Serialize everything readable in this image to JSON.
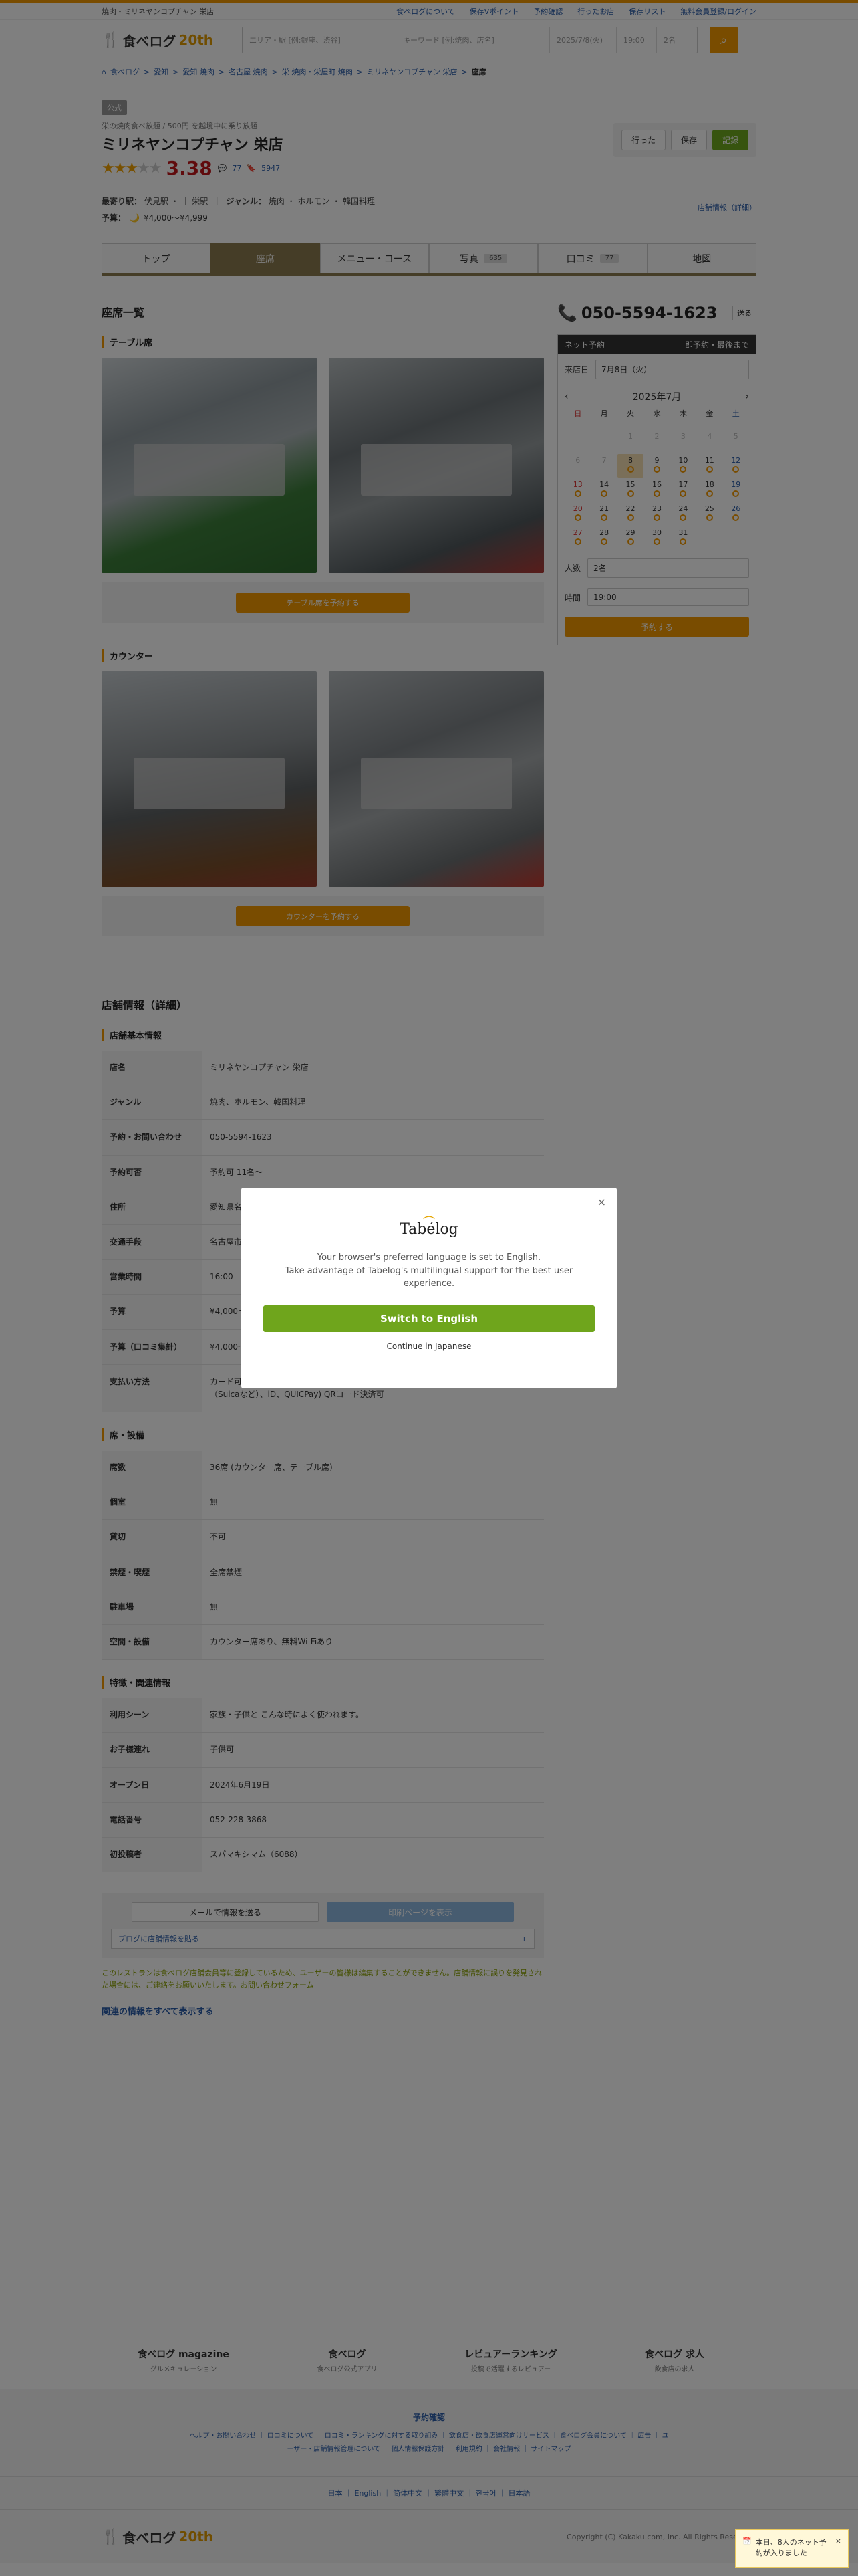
{
  "header": {
    "top_text": "焼肉・ミリネヤンコプチャン 栄店",
    "links": [
      "食べログについて",
      "保存Vポイント",
      "予約確認",
      "行ったお店",
      "保存リスト",
      "無料会員登録/ログイン"
    ],
    "logo_text": "食べログ",
    "logo_anniv": "20th",
    "search_area_placeholder": "エリア・駅 [例:銀座、渋谷]",
    "search_keyword_placeholder": "キーワード [例:焼肉、店名]",
    "search_date": "2025/7/8(火)",
    "search_time": "19:00",
    "search_people": "2名"
  },
  "breadcrumb": [
    "食べログ",
    "愛知",
    "愛知 焼肉",
    "名古屋 焼肉",
    "栄 焼肉・栄屋町 焼肉",
    "ミリネヤンコプチャン 栄店",
    "座席"
  ],
  "shop": {
    "badge": "公式",
    "subtitle": "栄の焼肉食べ放題 / 500円 を越境中に乗り放題",
    "name": "ミリネヤンコプチャン 栄店",
    "score": "3.38",
    "stars": 3,
    "reviews": "77",
    "saves": "5947",
    "nearest_label": "最寄り駅：",
    "nearest": "伏見駅 ・ ｜ 栄駅",
    "genre_label": "ジャンル：",
    "genre": "焼肉 ・ ホルモン ・ 韓国料理",
    "budget_label": "予算：",
    "budget": "¥4,000～¥4,999",
    "went_btn": "行った",
    "save_btn": "保存",
    "reserve_btn": "記録",
    "report_link": "店舗情報（詳細）"
  },
  "tabs": [
    {
      "label": "トップ",
      "count": ""
    },
    {
      "label": "座席",
      "count": ""
    },
    {
      "label": "メニュー・コース",
      "count": ""
    },
    {
      "label": "写真",
      "count": "635"
    },
    {
      "label": "口コミ",
      "count": "77"
    },
    {
      "label": "地図",
      "count": ""
    }
  ],
  "seats": {
    "title": "座席一覧",
    "table_title": "テーブル席",
    "table_btn": "テーブル席を予約する",
    "counter_title": "カウンター",
    "counter_btn": "カウンターを予約する"
  },
  "details": {
    "title": "店舗情報（詳細）",
    "basic_title": "店舗基本情報",
    "rows": [
      {
        "k": "店名",
        "v": "ミリネヤンコプチャン 栄店"
      },
      {
        "k": "ジャンル",
        "v": "焼肉、ホルモン、韓国料理"
      },
      {
        "k": "予約・お問い合わせ",
        "v": "050-5594-1623"
      },
      {
        "k": "予約可否",
        "v": "予約可 11名～"
      },
      {
        "k": "住所",
        "v": "愛知県名古屋市..."
      },
      {
        "k": "交通手段",
        "v": "名古屋市営東山線 伏見駅から586m"
      },
      {
        "k": "営業時間",
        "v": "16:00 - 23:30 L.O. 23:00"
      },
      {
        "k": "予算",
        "v": "¥4,000～¥4,999"
      },
      {
        "k": "予算（口コミ集計）",
        "v": "¥4,000～¥4,999"
      },
      {
        "k": "支払い方法",
        "v": "カード可 (VISA、Master、JCB、AMEX、Diners) 電子マネー可 (交通系電子マネー（Suicaなど）、iD、QUICPay) QRコード決済可"
      }
    ],
    "budget_dist_link": "利用金額分布を見る",
    "seat_title": "席・設備",
    "seat_rows": [
      {
        "k": "席数",
        "v": "36席 (カウンター席、テーブル席)"
      },
      {
        "k": "個室",
        "v": "無"
      },
      {
        "k": "貸切",
        "v": "不可"
      },
      {
        "k": "禁煙・喫煙",
        "v": "全席禁煙"
      },
      {
        "k": "駐車場",
        "v": "無"
      },
      {
        "k": "空間・設備",
        "v": "カウンター席あり、無料Wi-Fiあり"
      }
    ],
    "feature_title": "特徴・関連情報",
    "feature_rows": [
      {
        "k": "利用シーン",
        "v": "家族・子供と こんな時によく使われます。"
      },
      {
        "k": "お子様連れ",
        "v": "子供可"
      },
      {
        "k": "オープン日",
        "v": "2024年6月19日"
      },
      {
        "k": "電話番号",
        "v": "052-228-3868"
      },
      {
        "k": "初投稿者",
        "v": "スパマキシマム（6088）"
      }
    ]
  },
  "footer_actions": {
    "mail_btn": "メールで情報を送る",
    "print_btn": "印刷ページを表示",
    "blog_link": "ブログに店舗情報を貼る",
    "disclaimer": "このレストランは食べログ店舗会員等に登録しているため、ユーザーの皆様は編集することができません。店舗情報に誤りを発見された場合には、ご連絡をお願いいたします。お問い合わせフォーム",
    "related": "関連の情報をすべて表示する"
  },
  "banners": [
    {
      "t": "食べログ magazine",
      "s": "グルメキュレーション"
    },
    {
      "t": "食べログ",
      "s": "食べログ公式アプリ"
    },
    {
      "t": "レビュアーランキング",
      "s": "投稿で活躍するレビュアー"
    },
    {
      "t": "食べログ 求人",
      "s": "飲食店の求人"
    }
  ],
  "footer": {
    "reserve": "予約確認",
    "links": "ヘルプ・お問い合わせ ｜ ロコミについて ｜ ロコミ・ランキングに対する取り組み ｜ 飲食店・飲食店運営向けサービス ｜ 食べログ会員について ｜ 広告 ｜ ユーザー・店舗情報管理について ｜ 個人情報保護方針 ｜ 利用規約 ｜ 会社情報 ｜ サイトマップ",
    "langs": "日本 ｜ English ｜ 简体中文 ｜ 繁體中文 ｜ 한국어 ｜ 日本語",
    "copyright": "Copyright (C) Kakaku.com, Inc. All Rights Reserved."
  },
  "sidebar": {
    "phone": "050-5594-1623",
    "share": "送る",
    "net_reserve": "ネット予約",
    "instant": "即予約・最後まで",
    "visit_label": "来店日",
    "visit_date": "7月8日（火）",
    "month": "2025年7月",
    "weekdays": [
      "日",
      "月",
      "火",
      "水",
      "木",
      "金",
      "土"
    ],
    "people_label": "人数",
    "people": "2名",
    "time_label": "時間",
    "time": "19:00",
    "submit": "予約する"
  },
  "modal": {
    "title": "Tabélog",
    "line1": "Your browser's preferred language is set to English.",
    "line2": "Take advantage of Tabelog's multilingual support for the best user experience.",
    "switch": "Switch to English",
    "continue": "Continue in Japanese"
  },
  "toast": {
    "text": "本日、8人のネット予約が入りました"
  }
}
